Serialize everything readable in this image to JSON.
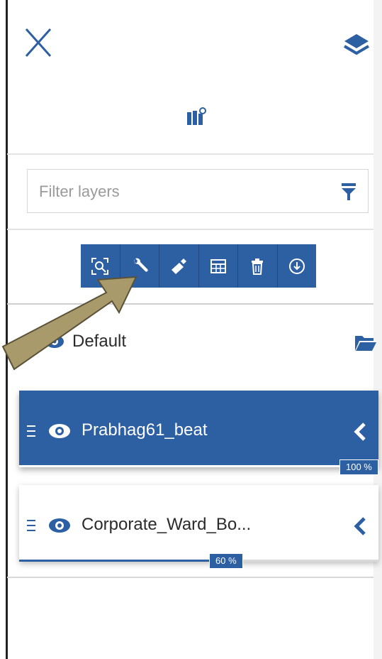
{
  "header": {
    "close_icon": "close-icon",
    "layers_icon": "layers-icon",
    "catalog_icon": "map-catalog-icon"
  },
  "filter": {
    "placeholder": "Filter layers",
    "icon": "filter-icon"
  },
  "toolbar": {
    "buttons": [
      {
        "icon": "zoom-to-extent-icon"
      },
      {
        "icon": "wrench-icon"
      },
      {
        "icon": "style-brush-icon"
      },
      {
        "icon": "table-icon"
      },
      {
        "icon": "trash-icon"
      },
      {
        "icon": "download-icon"
      }
    ],
    "accent": "#2d5fa3"
  },
  "group": {
    "label": "Default",
    "eye_icon": "eye-icon",
    "folder_icon": "folder-open-icon"
  },
  "layers": [
    {
      "name": "Prabhag61_beat",
      "opacity": 100,
      "opacity_label": "100 %",
      "selected": true
    },
    {
      "name": "Corporate_Ward_Bo...",
      "opacity": 60,
      "opacity_label": "60 %",
      "selected": false
    }
  ],
  "annotation": {
    "arrow_color": "#a89a6a",
    "target": "wrench-icon"
  }
}
